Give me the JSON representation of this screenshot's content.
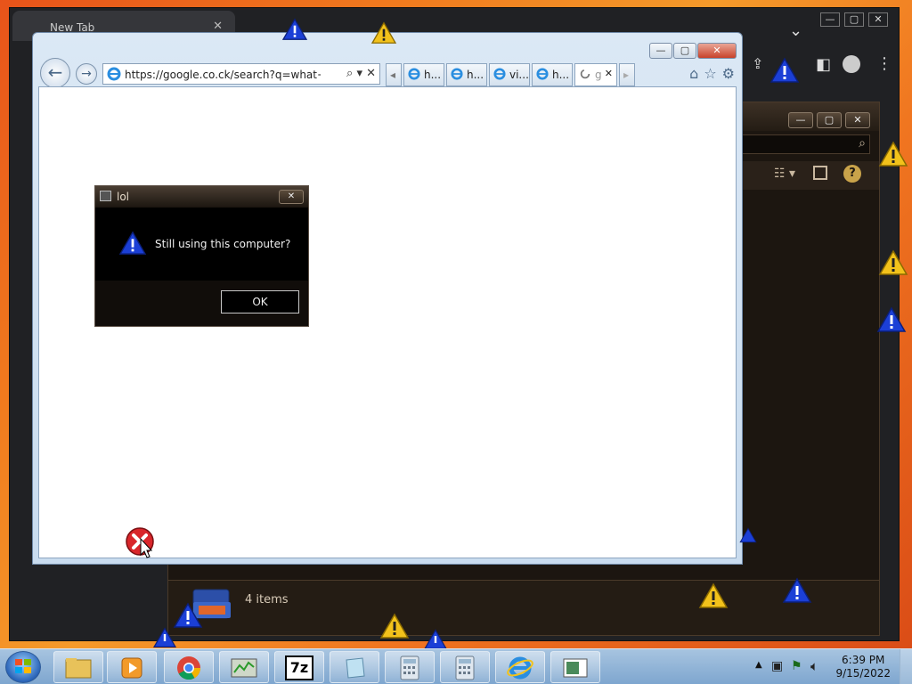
{
  "chrome": {
    "tab_title": "New Tab",
    "tab_close": "✕",
    "controls": [
      "—",
      "▢",
      "✕"
    ],
    "tab_menu": "⌄"
  },
  "explorer": {
    "status_text": "4 items",
    "controls": [
      "—",
      "▢",
      "✕"
    ],
    "help": "?"
  },
  "ie": {
    "url": "https://google.co.ck/search?q=what+happe",
    "addr_tools": "⌕ ▾  ✕",
    "controls": {
      "min": "—",
      "max": "▢",
      "close": "✕"
    },
    "tabs": [
      {
        "label": "h..."
      },
      {
        "label": "h..."
      },
      {
        "label": "vi..."
      },
      {
        "label": "h..."
      },
      {
        "label": "g",
        "close": "✕",
        "active": true
      }
    ],
    "right_icons": [
      "⌂",
      "☆",
      "⚙"
    ]
  },
  "dialog": {
    "title": "lol",
    "close_glyph": "✕",
    "message": "Still using this computer?",
    "ok_label": "OK"
  },
  "taskbar": {
    "apps": [
      "explorer-folder-icon",
      "media-player-icon",
      "chrome-icon",
      "task-manager-icon",
      "7zip-icon",
      "notepad-icon",
      "calculator-icon",
      "calculator-icon",
      "internet-explorer-icon",
      "monitor-icon"
    ],
    "seven_zip_label": "7z",
    "time": "6:39 PM",
    "date": "9/15/2022"
  },
  "colors": {
    "warning_blue": "#1b3fd6",
    "warning_yellow": "#f2c21b",
    "desktop_orange": "#f07a1e"
  }
}
